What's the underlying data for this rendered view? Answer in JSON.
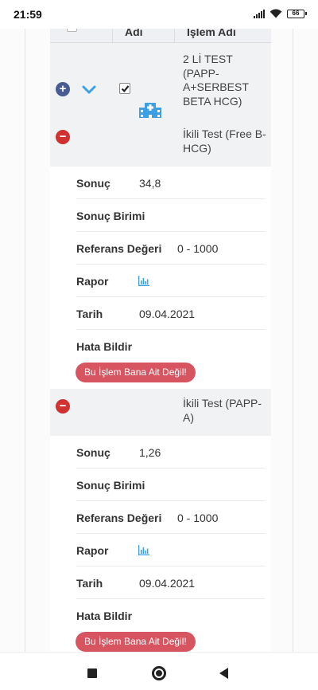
{
  "status_bar": {
    "time": "21:59",
    "battery": "66"
  },
  "table": {
    "header": {
      "col_name": "Adı",
      "col_process": "İşlem Adı"
    },
    "group": {
      "expand_symbol": "+",
      "checked": true,
      "name": "2 Lİ TEST (PAPP-A+SERBEST BETA HCG)"
    },
    "tests": [
      {
        "collapse_symbol": "−",
        "name": "İkili Test (Free B-HCG)",
        "sonuc_label": "Sonuç",
        "sonuc_value": "34,8",
        "birim_label": "Sonuç Birimi",
        "birim_value": "",
        "referans_label": "Referans Değeri",
        "referans_value": "0 - 1000",
        "rapor_label": "Rapor",
        "tarih_label": "Tarih",
        "tarih_value": "09.04.2021",
        "hata_label": "Hata Bildir",
        "hata_button": "Bu İşlem Bana Ait Değil!"
      },
      {
        "collapse_symbol": "−",
        "name": "İkili Test (PAPP-A)",
        "sonuc_label": "Sonuç",
        "sonuc_value": "1,26",
        "birim_label": "Sonuç Birimi",
        "birim_value": "",
        "referans_label": "Referans Değeri",
        "referans_value": "0 - 1000",
        "rapor_label": "Rapor",
        "tarih_label": "Tarih",
        "tarih_value": "09.04.2021",
        "hata_label": "Hata Bildir",
        "hata_button": "Bu İşlem Bana Ait Değil!"
      }
    ]
  },
  "icons": {
    "expand": "plus-circle-icon",
    "collapse": "minus-circle-icon",
    "chevron": "chevron-down-icon",
    "institution": "hospital-icon",
    "report": "bar-chart-icon"
  },
  "colors": {
    "expand_button": "#485c91",
    "collapse_button": "#d03232",
    "chevron": "#3ea0e4",
    "report_icon": "#3ea0e4",
    "error_button": "#d65561",
    "group_row_bg": "#f1f2f4"
  }
}
